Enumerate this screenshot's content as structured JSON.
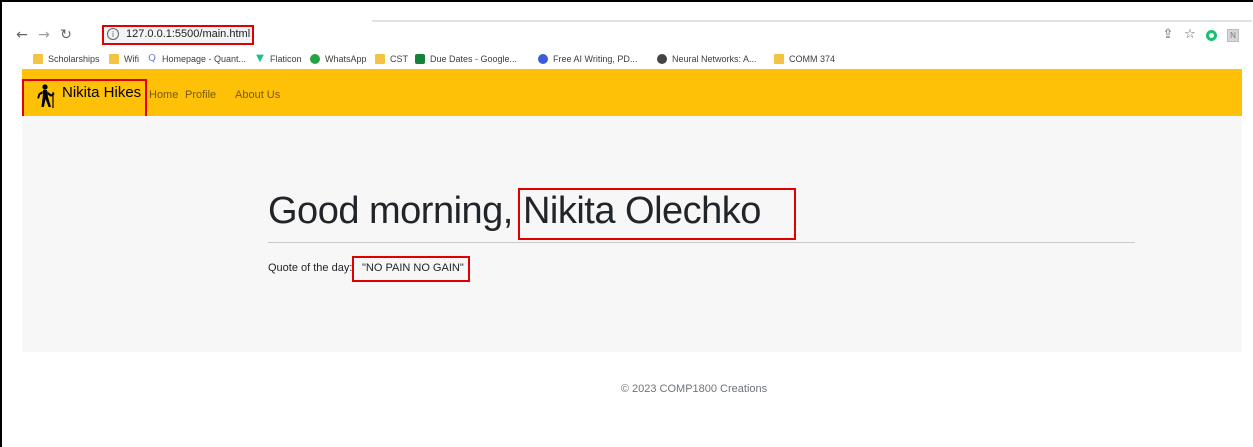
{
  "browser": {
    "url": "127.0.0.1:5500/main.html",
    "bookmarks": [
      {
        "label": "Scholarships",
        "icon": "folder-icon",
        "color": "#f5c342"
      },
      {
        "label": "Wifi",
        "icon": "folder-icon",
        "color": "#f5c342"
      },
      {
        "label": "Homepage - Quant...",
        "icon": "quantum-icon",
        "color": "#6b7fd7"
      },
      {
        "label": "Flaticon",
        "icon": "flaticon-icon",
        "color": "#1fbf8f"
      },
      {
        "label": "WhatsApp",
        "icon": "whatsapp-icon",
        "color": "#25a244"
      },
      {
        "label": "CST",
        "icon": "folder-icon",
        "color": "#f5c342"
      },
      {
        "label": "Due Dates - Google...",
        "icon": "sheets-icon",
        "color": "#188038"
      },
      {
        "label": "Free AI Writing, PD...",
        "icon": "ai-writing-icon",
        "color": "#3b5bdb"
      },
      {
        "label": "Neural Networks: A...",
        "icon": "globe-icon",
        "color": "#444444"
      },
      {
        "label": "COMM 374",
        "icon": "folder-icon",
        "color": "#f5c342"
      }
    ]
  },
  "navbar": {
    "brand": "Nikita Hikes",
    "links": [
      "Home",
      "Profile",
      "About Us"
    ],
    "color": "#ffc107"
  },
  "hero": {
    "greeting_prefix": "Good morning,",
    "user_name": "Nikita Olechko",
    "quote_label": "Quote of the day:",
    "quote": "\"NO PAIN NO GAIN\""
  },
  "footer": {
    "text": "© 2023 COMP1800 Creations"
  },
  "annotation_color": "#e00000"
}
